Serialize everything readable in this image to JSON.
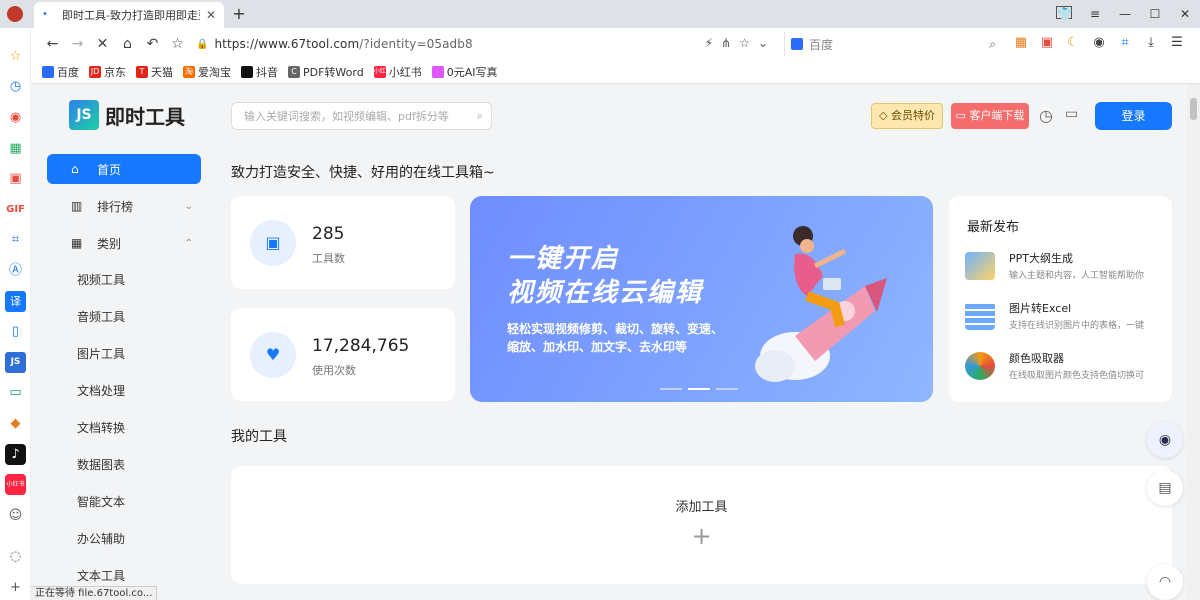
{
  "browser": {
    "tab_title": "即时工具-致力打造即用即走型在",
    "tab_count": "1",
    "url": "https://www.67tool.com/?identity=05adb8",
    "url_host": "https://www.67tool.com",
    "url_rest": "/?identity=05adb8",
    "search_placeholder": "百度",
    "bookmarks": [
      "百度",
      "京东",
      "天猫",
      "爱淘宝",
      "抖音",
      "PDF转Word",
      "小红书",
      "0元AI写真"
    ],
    "bookmark_icon_letters": [
      "",
      "JD",
      "T",
      "淘",
      "",
      "C",
      "小红书",
      ""
    ],
    "status_text": "正在等待 file.67tool.co..."
  },
  "site": {
    "logo_name": "即时工具",
    "logo_mark": "JS",
    "search_placeholder": "输入关键词搜索，如视频编辑、pdf拆分等",
    "vip_label": "会员特价",
    "client_label": "客户端下载",
    "login_label": "登录"
  },
  "menu": {
    "items": [
      {
        "label": "首页",
        "icon": "home-icon"
      },
      {
        "label": "排行榜",
        "icon": "bar-chart-icon"
      },
      {
        "label": "类别",
        "icon": "grid-icon"
      }
    ],
    "sub_items": [
      "视频工具",
      "音频工具",
      "图片工具",
      "文档处理",
      "文档转换",
      "数据图表",
      "智能文本",
      "办公辅助",
      "文本工具"
    ]
  },
  "main": {
    "tagline": "致力打造安全、快捷、好用的在线工具箱~",
    "stats": [
      {
        "value": "285",
        "label": "工具数",
        "icon": "box-icon"
      },
      {
        "value": "17,284,765",
        "label": "使用次数",
        "icon": "heart-icon"
      }
    ],
    "banner": {
      "line1": "一键开启",
      "line2": "视频在线云编辑",
      "desc": "轻松实现视频修剪、裁切、旋转、变速、缩放、加水印、加文字、去水印等",
      "active_slide": 2,
      "slide_count": 3
    },
    "newest": {
      "title": "最新发布",
      "items": [
        {
          "name": "PPT大纲生成",
          "desc": "输入主题和内容，人工智能帮助你"
        },
        {
          "name": "图片转Excel",
          "desc": "支持在线识别图片中的表格，一键"
        },
        {
          "name": "颜色吸取器",
          "desc": "在线吸取图片颜色支持色值切换可"
        }
      ]
    },
    "mytools_title": "我的工具",
    "add_tool_label": "添加工具",
    "add_symbol": "+"
  }
}
